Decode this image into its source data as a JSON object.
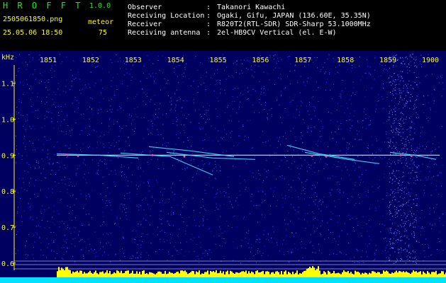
{
  "app": {
    "name": "H R O F F T",
    "version": "1.0.0"
  },
  "file": {
    "name": "2505061850.png",
    "datetime": "25.05.06 18:50"
  },
  "meteor": {
    "label": "meteor",
    "count": "75"
  },
  "info": [
    {
      "label": "Observer",
      "sep": ":",
      "value": "Takanori Kawachi"
    },
    {
      "label": "Receiving Location",
      "sep": ":",
      "value": "Ogaki, Gifu, JAPAN (136.60E, 35.35N)"
    },
    {
      "label": "Receiver",
      "sep": ":",
      "value": "R820T2(RTL-SDR) SDR-Sharp 53.1000MHz"
    },
    {
      "label": "Receiving antenna",
      "sep": ":",
      "value": "2el-HB9CV Vertical (el. E-W)"
    }
  ],
  "colors": {
    "title": "#00ff00",
    "text": "#ffffff",
    "yellow": "#ffff00",
    "plot_bg": "#000060",
    "cyan": "#00e0ff"
  },
  "chart_data": {
    "type": "heatmap",
    "ylabel": "kHz",
    "x_ticks": [
      "1851",
      "1852",
      "1853",
      "1854",
      "1855",
      "1856",
      "1857",
      "1858",
      "1859",
      "1900"
    ],
    "y_ticks": [
      "1.1",
      "1.0",
      "0.9",
      "0.8",
      "0.7",
      "0.6"
    ],
    "ylim": [
      0.58,
      1.18
    ],
    "carrier_khz": 0.9
  }
}
